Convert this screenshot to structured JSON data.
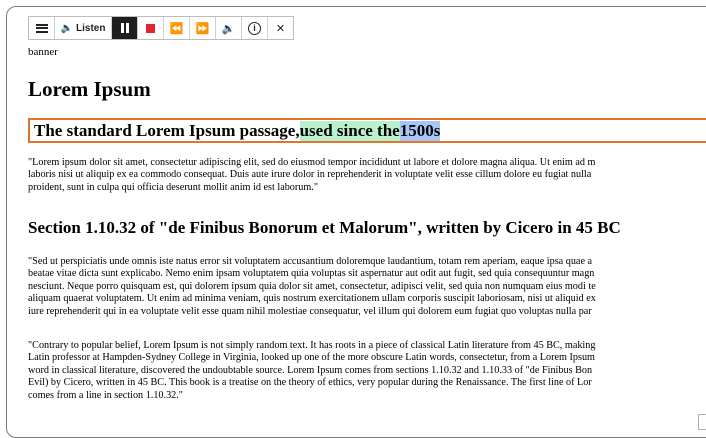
{
  "toolbar": {
    "listen_label": "Listen",
    "buttons": [
      {
        "name": "menu",
        "icon": "menu-icon"
      },
      {
        "name": "listen",
        "icon": "speaker-icon"
      },
      {
        "name": "pause",
        "icon": "pause-icon"
      },
      {
        "name": "stop",
        "icon": "stop-icon"
      },
      {
        "name": "rewind",
        "icon": "rewind-icon"
      },
      {
        "name": "forward",
        "icon": "forward-icon"
      },
      {
        "name": "volume",
        "icon": "volume-icon"
      },
      {
        "name": "info",
        "icon": "info-icon"
      },
      {
        "name": "close",
        "icon": "close-icon"
      }
    ],
    "colors": {
      "stop": "#e0262e",
      "pause_bg": "#1f1f1f"
    }
  },
  "page": {
    "banner": "banner",
    "title": "Lorem Ipsum",
    "heading2": {
      "plain": "The standard Lorem Ipsum passage, ",
      "highlight_green": "used since the ",
      "highlight_blue": "1500s",
      "highlight_colors": {
        "green": "#b9f1cf",
        "blue": "#a8c6f3",
        "border": "#e0762a"
      }
    },
    "para1": [
      "\"Lorem ipsum dolor sit amet, consectetur adipiscing elit, sed do eiusmod tempor incididunt ut labore et dolore magna aliqua. Ut enim ad m",
      "laboris nisi ut aliquip ex ea commodo consequat. Duis aute irure dolor in reprehenderit in voluptate velit esse cillum dolore eu fugiat nulla",
      "proident, sunt in culpa qui officia deserunt mollit anim id est laborum.\""
    ],
    "section_heading": "Section 1.10.32 of \"de Finibus Bonorum et Malorum\", written by Cicero in 45 BC",
    "para2": [
      "\"Sed ut perspiciatis unde omnis iste natus error sit voluptatem accusantium doloremque laudantium, totam rem aperiam, eaque ipsa quae a",
      "beatae vitae dicta sunt explicabo. Nemo enim ipsam voluptatem quia voluptas sit aspernatur aut odit aut fugit, sed quia consequuntur magn",
      "nesciunt. Neque porro quisquam est, qui dolorem ipsum quia dolor sit amet, consectetur, adipisci velit, sed quia non numquam eius modi te",
      "aliquam quaerat voluptatem. Ut enim ad minima veniam, quis nostrum exercitationem ullam corporis suscipit laboriosam, nisi ut aliquid ex",
      "iure reprehenderit qui in ea voluptate velit esse quam nihil molestiae consequatur, vel illum qui dolorem eum fugiat quo voluptas nulla par"
    ],
    "para3": [
      "\"Contrary to popular belief, Lorem Ipsum is not simply random text. It has roots in a piece of classical Latin literature from 45 BC, making",
      "Latin professor at Hampden-Sydney College in Virginia, looked up one of the more obscure Latin words, consectetur, from a Lorem Ipsum",
      "word in classical literature, discovered the undoubtable source. Lorem Ipsum comes from sections 1.10.32 and 1.10.33 of \"de Finibus Bon",
      "Evil) by Cicero, written in 45 BC. This book is a treatise on the theory of ethics, very popular during the Renaissance. The first line of Lor",
      "comes from a line in section 1.10.32.\""
    ]
  }
}
